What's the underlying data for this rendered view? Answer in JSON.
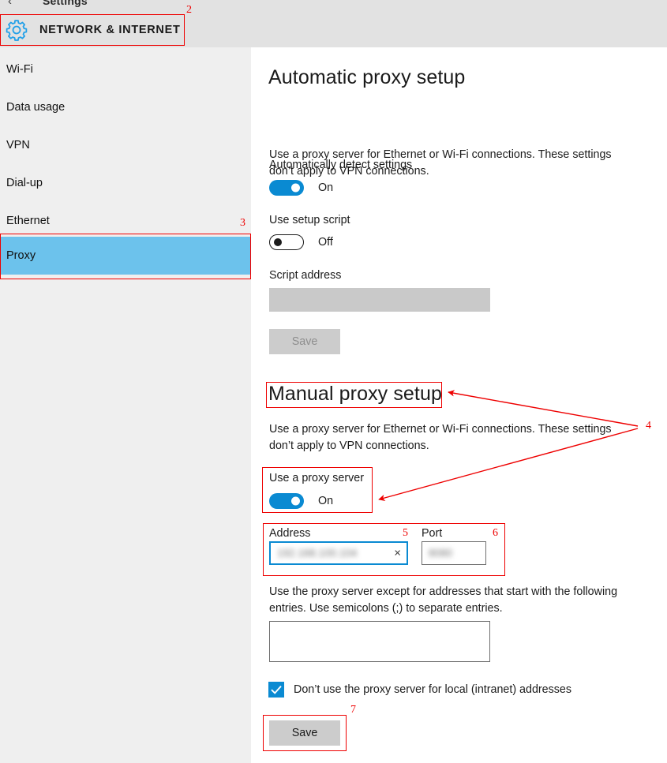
{
  "window": {
    "back_arrow": "‹",
    "app_title": "Settings",
    "category": "NETWORK & INTERNET",
    "gear_icon": "gear-icon"
  },
  "sidebar": {
    "items": [
      {
        "label": "Wi-Fi",
        "selected": false
      },
      {
        "label": "Data usage",
        "selected": false
      },
      {
        "label": "VPN",
        "selected": false
      },
      {
        "label": "Dial-up",
        "selected": false
      },
      {
        "label": "Ethernet",
        "selected": false
      },
      {
        "label": "Proxy",
        "selected": true
      }
    ]
  },
  "automatic": {
    "heading": "Automatic proxy setup",
    "description": "Use a proxy server for Ethernet or Wi-Fi connections. These settings don’t apply to VPN connections.",
    "auto_detect_label": "Automatically detect settings",
    "auto_detect_state": "On",
    "setup_script_label": "Use setup script",
    "setup_script_state": "Off",
    "script_address_label": "Script address",
    "script_address_value": "",
    "save_label": "Save"
  },
  "manual": {
    "heading": "Manual proxy setup",
    "description": "Use a proxy server for Ethernet or Wi-Fi connections. These settings don’t apply to VPN connections.",
    "use_proxy_label": "Use a proxy server",
    "use_proxy_state": "On",
    "address_label": "Address",
    "address_value": "192.168.100.104",
    "clear_icon": "×",
    "port_label": "Port",
    "port_value": "8080",
    "exceptions_description": "Use the proxy server except for addresses that start with the following entries. Use semicolons (;) to separate entries.",
    "exceptions_value": "",
    "bypass_local_label": "Don’t use the proxy server for local (intranet) addresses",
    "bypass_local_checked": true,
    "save_label": "Save"
  },
  "annotations": {
    "callouts": [
      {
        "number": "2"
      },
      {
        "number": "3"
      },
      {
        "number": "4"
      },
      {
        "number": "5"
      },
      {
        "number": "6"
      },
      {
        "number": "7"
      }
    ],
    "color": "#ee0000"
  },
  "colors": {
    "accent_blue": "#0a8ad2",
    "selection_blue": "#6cc2ec",
    "titlebar_gray": "#e2e2e2",
    "sidebar_gray": "#efefef",
    "disabled_gray": "#c9c9c9",
    "annotation_red": "#ee0000"
  }
}
